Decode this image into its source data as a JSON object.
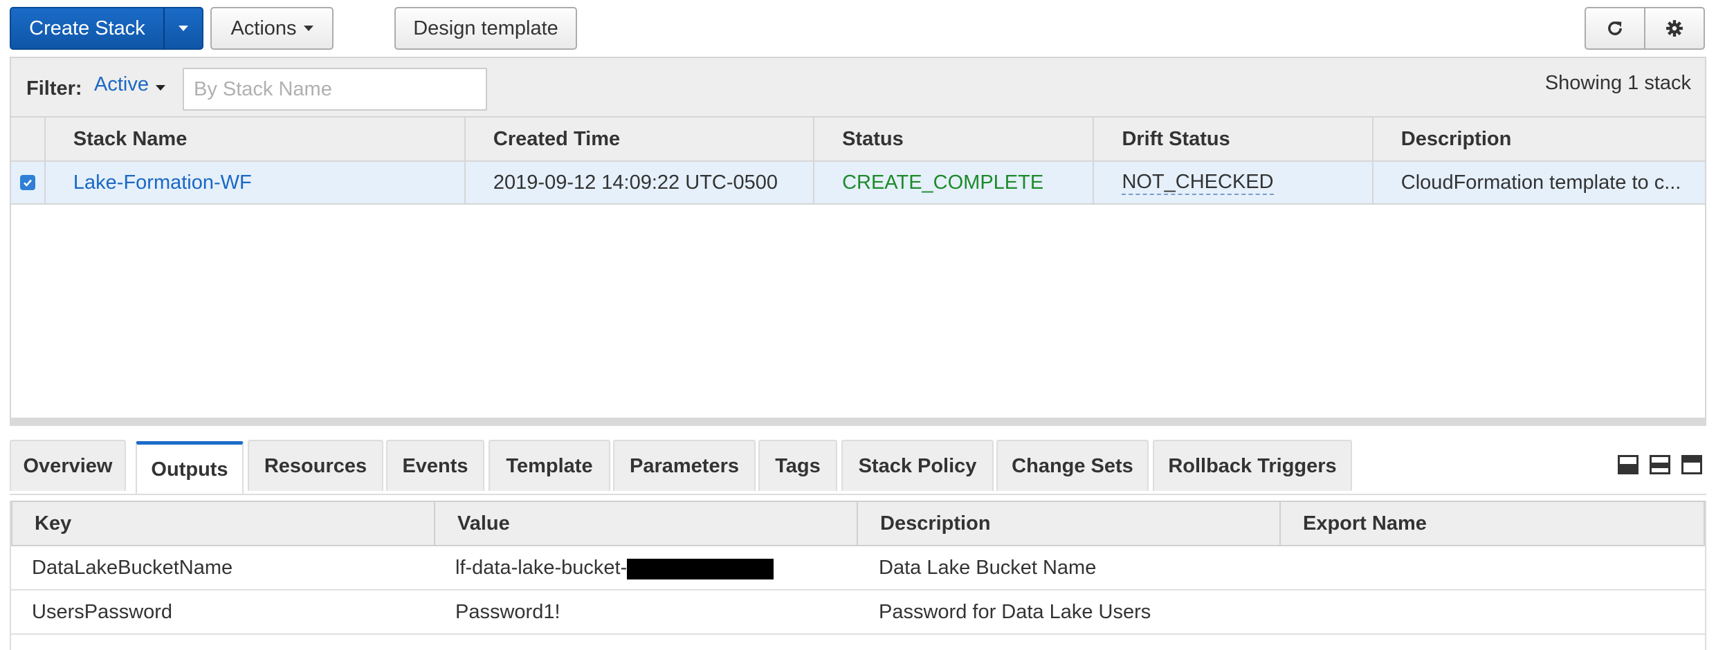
{
  "toolbar": {
    "create_stack_label": "Create Stack",
    "actions_label": "Actions",
    "design_template_label": "Design template"
  },
  "filter": {
    "label": "Filter:",
    "value": "Active",
    "placeholder": "By Stack Name",
    "showing": "Showing 1 stack"
  },
  "stack_table": {
    "columns": [
      "Stack Name",
      "Created Time",
      "Status",
      "Drift Status",
      "Description"
    ],
    "rows": [
      {
        "selected": true,
        "name": "Lake-Formation-WF",
        "created": "2019-09-12 14:09:22 UTC-0500",
        "status": "CREATE_COMPLETE",
        "drift": "NOT_CHECKED",
        "description": "CloudFormation template to c..."
      }
    ]
  },
  "tabs": [
    "Overview",
    "Outputs",
    "Resources",
    "Events",
    "Template",
    "Parameters",
    "Tags",
    "Stack Policy",
    "Change Sets",
    "Rollback Triggers"
  ],
  "active_tab": "Outputs",
  "outputs": {
    "columns": [
      "Key",
      "Value",
      "Description",
      "Export Name"
    ],
    "rows": [
      {
        "key": "DataLakeBucketName",
        "value": "lf-data-lake-bucket-",
        "value_redacted": true,
        "description": "Data Lake Bucket Name",
        "export": ""
      },
      {
        "key": "UsersPassword",
        "value": "Password1!",
        "value_redacted": false,
        "description": "Password for Data Lake Users",
        "export": ""
      }
    ]
  },
  "colors": {
    "primary": "#1a6bc7",
    "link": "#1a68c4",
    "status_complete": "#1d8a2a",
    "selected_row": "#e5f0fb"
  }
}
